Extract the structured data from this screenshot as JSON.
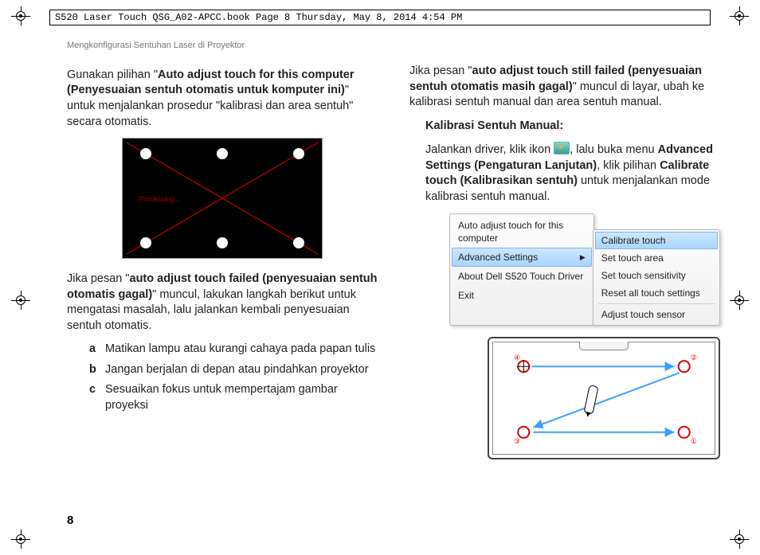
{
  "book_header": "S520 Laser Touch QSG_A02-APCC.book  Page 8  Thursday, May 8, 2014  4:54 PM",
  "section_title": "Mengkonfigurasi Sentuhan Laser di Proyektor",
  "left": {
    "p1_a": "Gunakan pilihan \"",
    "p1_b": "Auto adjust touch for this computer (Penyesuaian sentuh otomatis untuk komputer ini)",
    "p1_c": "\" untuk menjalankan prosedur \"kalibrasi dan area sentuh\" secara otomatis.",
    "fig1_label": "Processing...",
    "p2_a": "Jika pesan \"",
    "p2_b": "auto adjust touch failed (penyesuaian sentuh otomatis gagal)",
    "p2_c": "\" muncul, lakukan langkah berikut untuk mengatasi masalah, lalu jalankan kembali penyesuaian sentuh otomatis.",
    "steps": {
      "a": "Matikan lampu atau kurangi cahaya pada papan tulis",
      "b": "Jangan berjalan di depan atau pindahkan proyektor",
      "c": "Sesuaikan fokus untuk mempertajam gambar proyeksi"
    }
  },
  "right": {
    "p1_a": "Jika pesan \"",
    "p1_b": "auto adjust touch still failed (penyesuaian sentuh otomatis masih gagal)",
    "p1_c": "\" muncul di layar, ubah ke kalibrasi sentuh manual dan area sentuh manual.",
    "h": "Kalibrasi Sentuh Manual:",
    "p2_a": "Jalankan driver, klik ikon ",
    "p2_b": ", lalu buka menu ",
    "p2_c": "Advanced Settings (Pengaturan Lanjutan)",
    "p2_d": ", klik pilihan ",
    "p2_e": "Calibrate touch (Kalibrasikan sentuh)",
    "p2_f": " untuk menjalankan mode kalibrasi sentuh manual."
  },
  "menu": {
    "left": {
      "i1": "Auto adjust touch for this computer",
      "i2": "Advanced Settings",
      "i3": "About Dell S520 Touch Driver",
      "i4": "Exit"
    },
    "right": {
      "i1": "Calibrate touch",
      "i2": "Set touch area",
      "i3": "Set touch sensitivity",
      "i4": "Reset all touch settings",
      "i5": "Adjust touch sensor"
    }
  },
  "cal_markers": {
    "m1": "①",
    "m2": "②",
    "m3": "③",
    "m4": "④"
  },
  "page_number": "8"
}
